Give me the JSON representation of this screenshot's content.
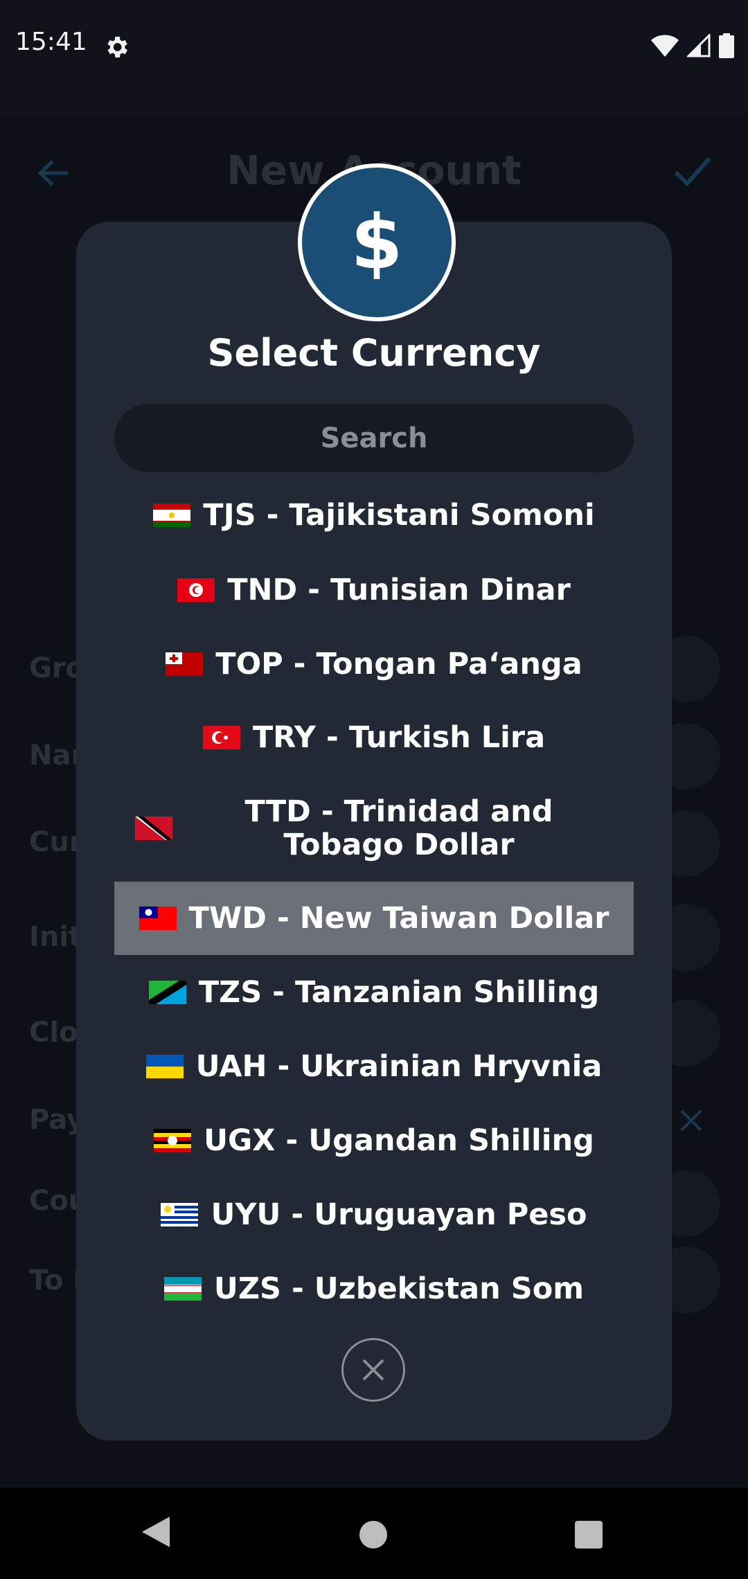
{
  "status_bar": {
    "time": "15:41"
  },
  "toolbar": {
    "title": "New Account"
  },
  "form_labels": [
    "Gro",
    "Nar",
    "Cur",
    "Init",
    "Clo",
    "Pay",
    "Cou",
    "To I"
  ],
  "dialog": {
    "icon_symbol": "$",
    "title": "Select Currency",
    "search_placeholder": "Search",
    "items": [
      {
        "label": "TJS - Tajikistani Somoni",
        "flag": "tj"
      },
      {
        "label": "TND - Tunisian Dinar",
        "flag": "tn"
      },
      {
        "label": "TOP - Tongan Paʻanga",
        "flag": "to"
      },
      {
        "label": "TRY - Turkish Lira",
        "flag": "tr"
      },
      {
        "label": "TTD - Trinidad and Tobago Dollar",
        "flag": "tt"
      },
      {
        "label": "TWD - New Taiwan Dollar",
        "flag": "tw",
        "selected": true
      },
      {
        "label": "TZS - Tanzanian Shilling",
        "flag": "tz"
      },
      {
        "label": "UAH - Ukrainian Hryvnia",
        "flag": "ua"
      },
      {
        "label": "UGX - Ugandan Shilling",
        "flag": "ug"
      },
      {
        "label": "UYU - Uruguayan Peso",
        "flag": "uy"
      },
      {
        "label": "UZS - Uzbekistan Som",
        "flag": "uz"
      }
    ]
  },
  "colors": {
    "dialog_bg": "#222834",
    "selected_bg": "#6a6f78",
    "accent": "#1b4e75",
    "toolbar_icon": "#173a52"
  }
}
